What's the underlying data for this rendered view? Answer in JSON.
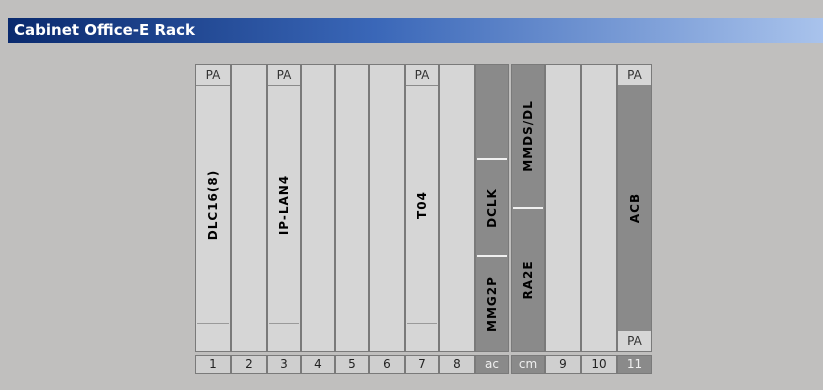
{
  "window": {
    "title": "Cabinet Office-E Rack"
  },
  "rack": {
    "slots": [
      {
        "num": "1",
        "top_label": "PA",
        "card_label": "DLC16(8)",
        "bottom_label": ""
      },
      {
        "num": "2",
        "top_label": "",
        "card_label": "",
        "bottom_label": ""
      },
      {
        "num": "3",
        "top_label": "PA",
        "card_label": "IP-LAN4",
        "bottom_label": ""
      },
      {
        "num": "4",
        "top_label": "",
        "card_label": "",
        "bottom_label": ""
      },
      {
        "num": "5",
        "top_label": "",
        "card_label": "",
        "bottom_label": ""
      },
      {
        "num": "6",
        "top_label": "",
        "card_label": "",
        "bottom_label": ""
      },
      {
        "num": "7",
        "top_label": "PA",
        "card_label": "T04",
        "bottom_label": ""
      },
      {
        "num": "8",
        "top_label": "",
        "card_label": "",
        "bottom_label": ""
      },
      {
        "num": "ac",
        "top_label": "",
        "card_label_top": "DCLK",
        "card_label_bottom": "MMG2P",
        "bottom_label": ""
      },
      {
        "num": "cm",
        "top_label": "",
        "card_label_top": "MMDS/DL",
        "card_label_bottom": "RA2E",
        "bottom_label": ""
      },
      {
        "num": "9",
        "top_label": "",
        "card_label": "",
        "bottom_label": ""
      },
      {
        "num": "10",
        "top_label": "",
        "card_label": "",
        "bottom_label": ""
      },
      {
        "num": "11",
        "top_label": "PA",
        "card_label": "ACB",
        "bottom_label": "PA"
      }
    ]
  },
  "colors": {
    "title_gradient_start": "#0a2a6e",
    "title_gradient_end": "#a9c3ec",
    "background": "#c0bfbe",
    "slot_light": "#d6d6d6",
    "slot_dark": "#8a8a8a"
  }
}
